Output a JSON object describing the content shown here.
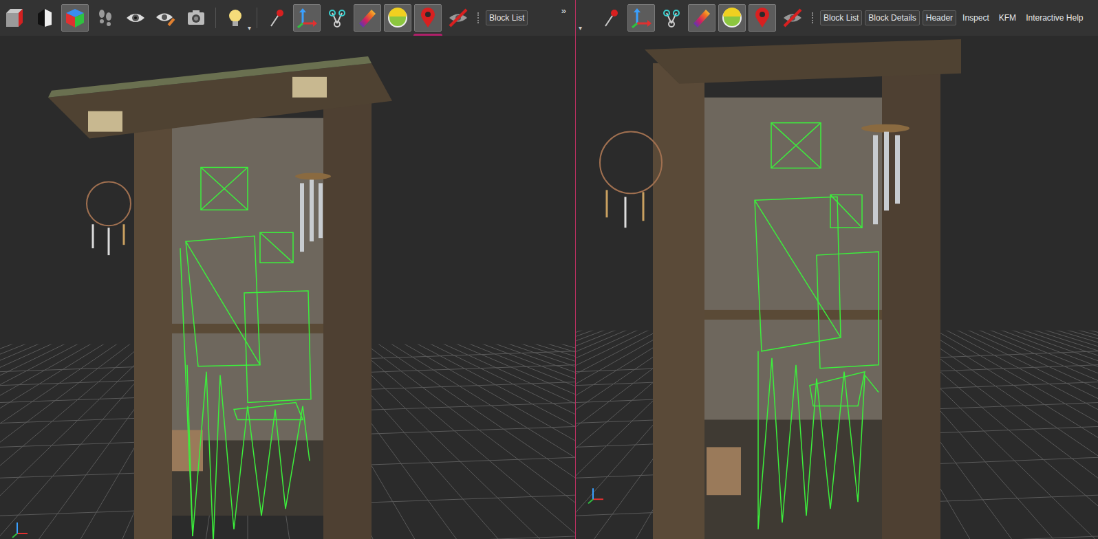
{
  "left": {
    "tools": [
      {
        "selected": false,
        "underlined": false
      },
      {
        "selected": false,
        "underlined": false
      },
      {
        "selected": true,
        "underlined": false
      },
      {
        "selected": false,
        "underlined": false
      },
      {
        "selected": false,
        "underlined": false
      },
      {
        "selected": false,
        "underlined": false
      },
      {
        "selected": false,
        "underlined": false
      },
      {
        "selected": false,
        "underlined": false
      },
      {
        "selected": false,
        "underlined": false
      },
      {
        "selected": true,
        "underlined": false
      },
      {
        "selected": false,
        "underlined": false
      },
      {
        "selected": true,
        "underlined": false
      },
      {
        "selected": true,
        "underlined": false
      },
      {
        "selected": true,
        "underlined": true
      },
      {
        "selected": false,
        "underlined": false
      }
    ],
    "dropdown_arrow": "▾",
    "buttons": [
      "Block List"
    ],
    "overflow": "»"
  },
  "right": {
    "menu_arrow": "▾",
    "tools": [
      {
        "selected": false
      },
      {
        "selected": true
      },
      {
        "selected": false
      },
      {
        "selected": true
      },
      {
        "selected": true
      },
      {
        "selected": true
      },
      {
        "selected": false
      }
    ],
    "buttons": [
      "Block List",
      "Block Details",
      "Header"
    ],
    "menus": [
      "Inspect",
      "KFM",
      "Interactive Help"
    ]
  }
}
